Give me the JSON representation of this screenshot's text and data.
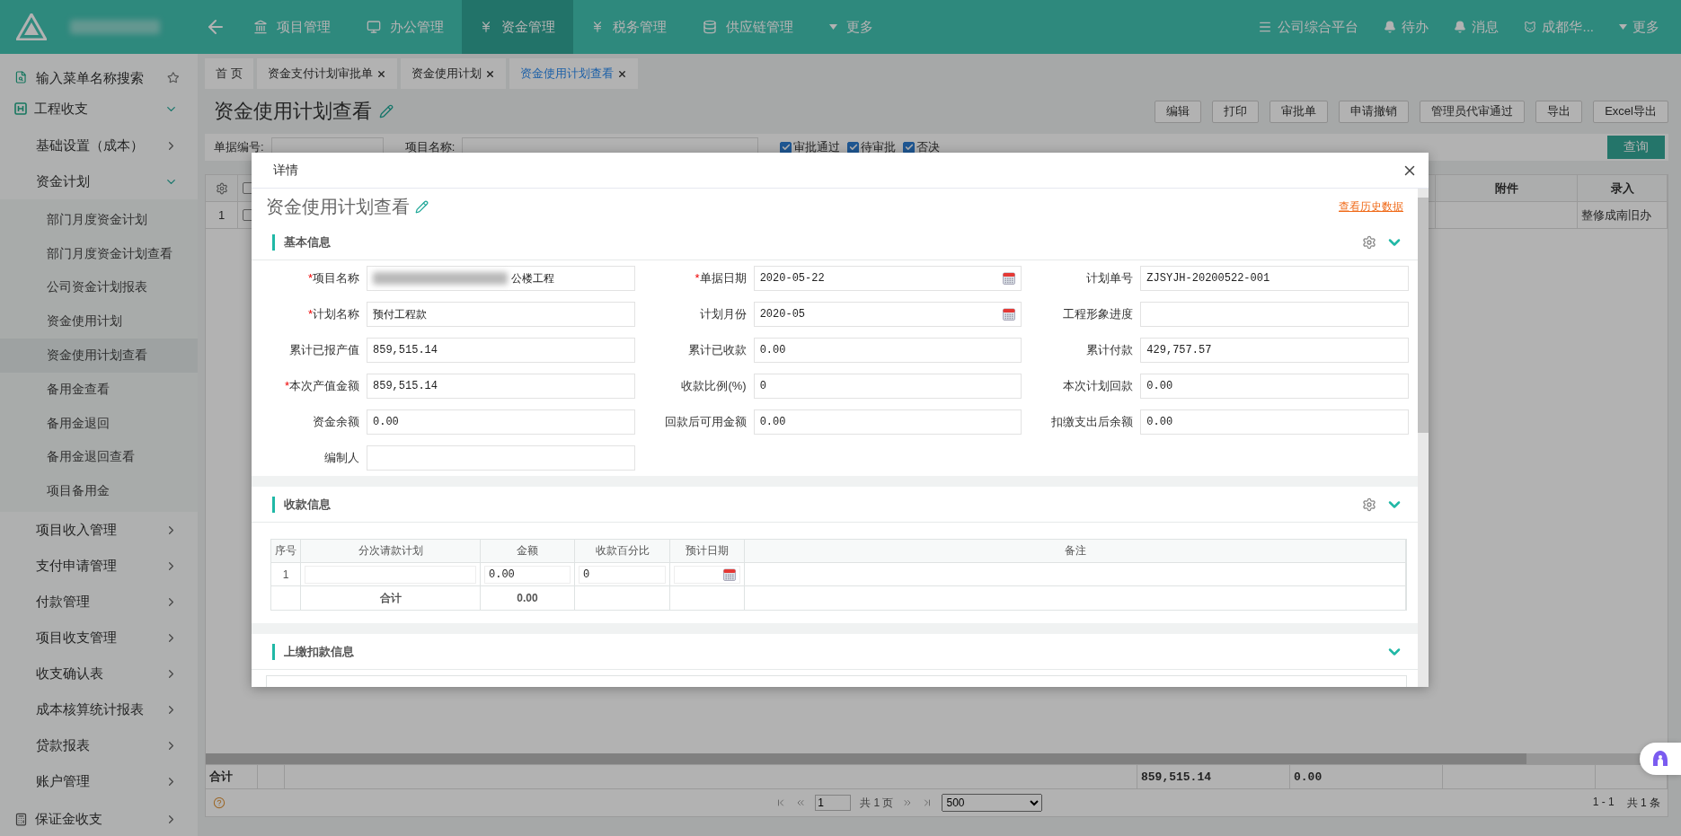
{
  "topbar": {
    "nav": [
      {
        "label": "项目管理",
        "selected": false
      },
      {
        "label": "办公管理",
        "selected": false
      },
      {
        "label": "资金管理",
        "selected": true
      },
      {
        "label": "税务管理",
        "selected": false
      },
      {
        "label": "供应链管理",
        "selected": false
      },
      {
        "label": "更多",
        "selected": false
      }
    ],
    "right": [
      {
        "label": "公司综合平台"
      },
      {
        "label": "待办"
      },
      {
        "label": "消息"
      },
      {
        "label": "成都华..."
      },
      {
        "label": "更多"
      }
    ]
  },
  "sidebar": {
    "search": {
      "placeholder": "输入菜单名称搜索"
    },
    "items": [
      {
        "label": "工程收支",
        "expanded": true,
        "children": [
          {
            "label": "基础设置（成本）",
            "expanded": false
          },
          {
            "label": "资金计划",
            "expanded": true,
            "children": [
              {
                "label": "部门月度资金计划",
                "selected": false
              },
              {
                "label": "部门月度资金计划查看",
                "selected": false
              },
              {
                "label": "公司资金计划报表",
                "selected": false
              },
              {
                "label": "资金使用计划",
                "selected": false
              },
              {
                "label": "资金使用计划查看",
                "selected": true
              },
              {
                "label": "备用金查看",
                "selected": false
              },
              {
                "label": "备用金退回",
                "selected": false
              },
              {
                "label": "备用金退回查看",
                "selected": false
              },
              {
                "label": "项目备用金",
                "selected": false
              }
            ]
          },
          {
            "label": "项目收入管理",
            "expanded": false
          },
          {
            "label": "支付申请管理",
            "expanded": false
          },
          {
            "label": "付款管理",
            "expanded": false
          },
          {
            "label": "项目收支管理",
            "expanded": false
          },
          {
            "label": "收支确认表",
            "expanded": false
          },
          {
            "label": "成本核算统计报表",
            "expanded": false
          },
          {
            "label": "贷款报表",
            "expanded": false
          },
          {
            "label": "账户管理",
            "expanded": false
          }
        ]
      },
      {
        "label": "保证金收支",
        "expanded": false
      }
    ]
  },
  "tabs": [
    {
      "label": "首 页",
      "closable": false,
      "selected": false
    },
    {
      "label": "资金支付计划审批单",
      "closable": true,
      "selected": false
    },
    {
      "label": "资金使用计划",
      "closable": true,
      "selected": false
    },
    {
      "label": "资金使用计划查看",
      "closable": true,
      "selected": true
    }
  ],
  "page": {
    "title": "资金使用计划查看",
    "buttons": [
      "编辑",
      "打印",
      "审批单",
      "申请撤销",
      "管理员代审通过",
      "导出",
      "Excel导出"
    ],
    "filters": [
      {
        "label": "单据编号:"
      },
      {
        "label": "项目名称:"
      }
    ],
    "checks": [
      {
        "label": "审批通过",
        "checked": true
      },
      {
        "label": "待审批",
        "checked": true
      },
      {
        "label": "否决",
        "checked": true
      }
    ],
    "search_button": "查询"
  },
  "table": {
    "all_checked": false,
    "columns": [
      "附件",
      "录入"
    ],
    "rows": [
      {
        "index": "1",
        "checked": false,
        "cells": [
          "",
          "整修成南旧办"
        ]
      }
    ],
    "sum_label": "合计",
    "sums": [
      "859,515.14",
      "0.00"
    ],
    "pager": {
      "page": "1",
      "pages": "共 1 页",
      "size": "500",
      "range": "1 - 1",
      "total": "共 1 条"
    }
  },
  "modal": {
    "title": "详情",
    "heading": "资金使用计划查看",
    "history_link": "查看历史数据",
    "sections": [
      {
        "kind": "form",
        "title": "基本信息",
        "settings": true,
        "fields": [
          {
            "required_mark": "*",
            "label": "项目名称",
            "redacted": true,
            "value": "公楼工程",
            "kind": "text"
          },
          {
            "required_mark": "*",
            "label": "单据日期",
            "value": "2020-05-22",
            "kind": "date"
          },
          {
            "label": "计划单号",
            "value": "ZJSYJH-20200522-001",
            "kind": "text"
          },
          {
            "required_mark": "*",
            "label": "计划名称",
            "value": "预付工程款",
            "kind": "text"
          },
          {
            "label": "计划月份",
            "value": "2020-05",
            "kind": "date"
          },
          {
            "label": "工程形象进度",
            "kind": "text"
          },
          {
            "label": "累计已报产值",
            "value": "859,515.14",
            "kind": "text"
          },
          {
            "label": "累计已收款",
            "value": "0.00",
            "kind": "text"
          },
          {
            "label": "累计付款",
            "value": "429,757.57",
            "kind": "text"
          },
          {
            "required_mark": "*",
            "label": "本次产值金额",
            "value": "859,515.14",
            "kind": "text"
          },
          {
            "label": "收款比例(%)",
            "value": "0",
            "kind": "text"
          },
          {
            "label": "本次计划回款",
            "value": "0.00",
            "kind": "text"
          },
          {
            "label": "资金余额",
            "value": "0.00",
            "kind": "text"
          },
          {
            "label": "回款后可用金额",
            "value": "0.00",
            "kind": "text"
          },
          {
            "label": "扣缴支出后余额",
            "value": "0.00",
            "kind": "text"
          },
          {
            "label": "编制人",
            "kind": "text"
          }
        ]
      },
      {
        "kind": "table",
        "title": "收款信息",
        "settings": true,
        "columns": [
          "序号",
          "分次请款计划",
          "金额",
          "收款百分比",
          "预计日期",
          "备注"
        ],
        "rows": [
          {
            "index": "1",
            "amount": "0.00",
            "percent": "0"
          }
        ],
        "total_label": "合计",
        "total_amount": "0.00"
      },
      {
        "kind": "table-cut",
        "title": "上缴扣款信息",
        "settings": false
      }
    ]
  }
}
